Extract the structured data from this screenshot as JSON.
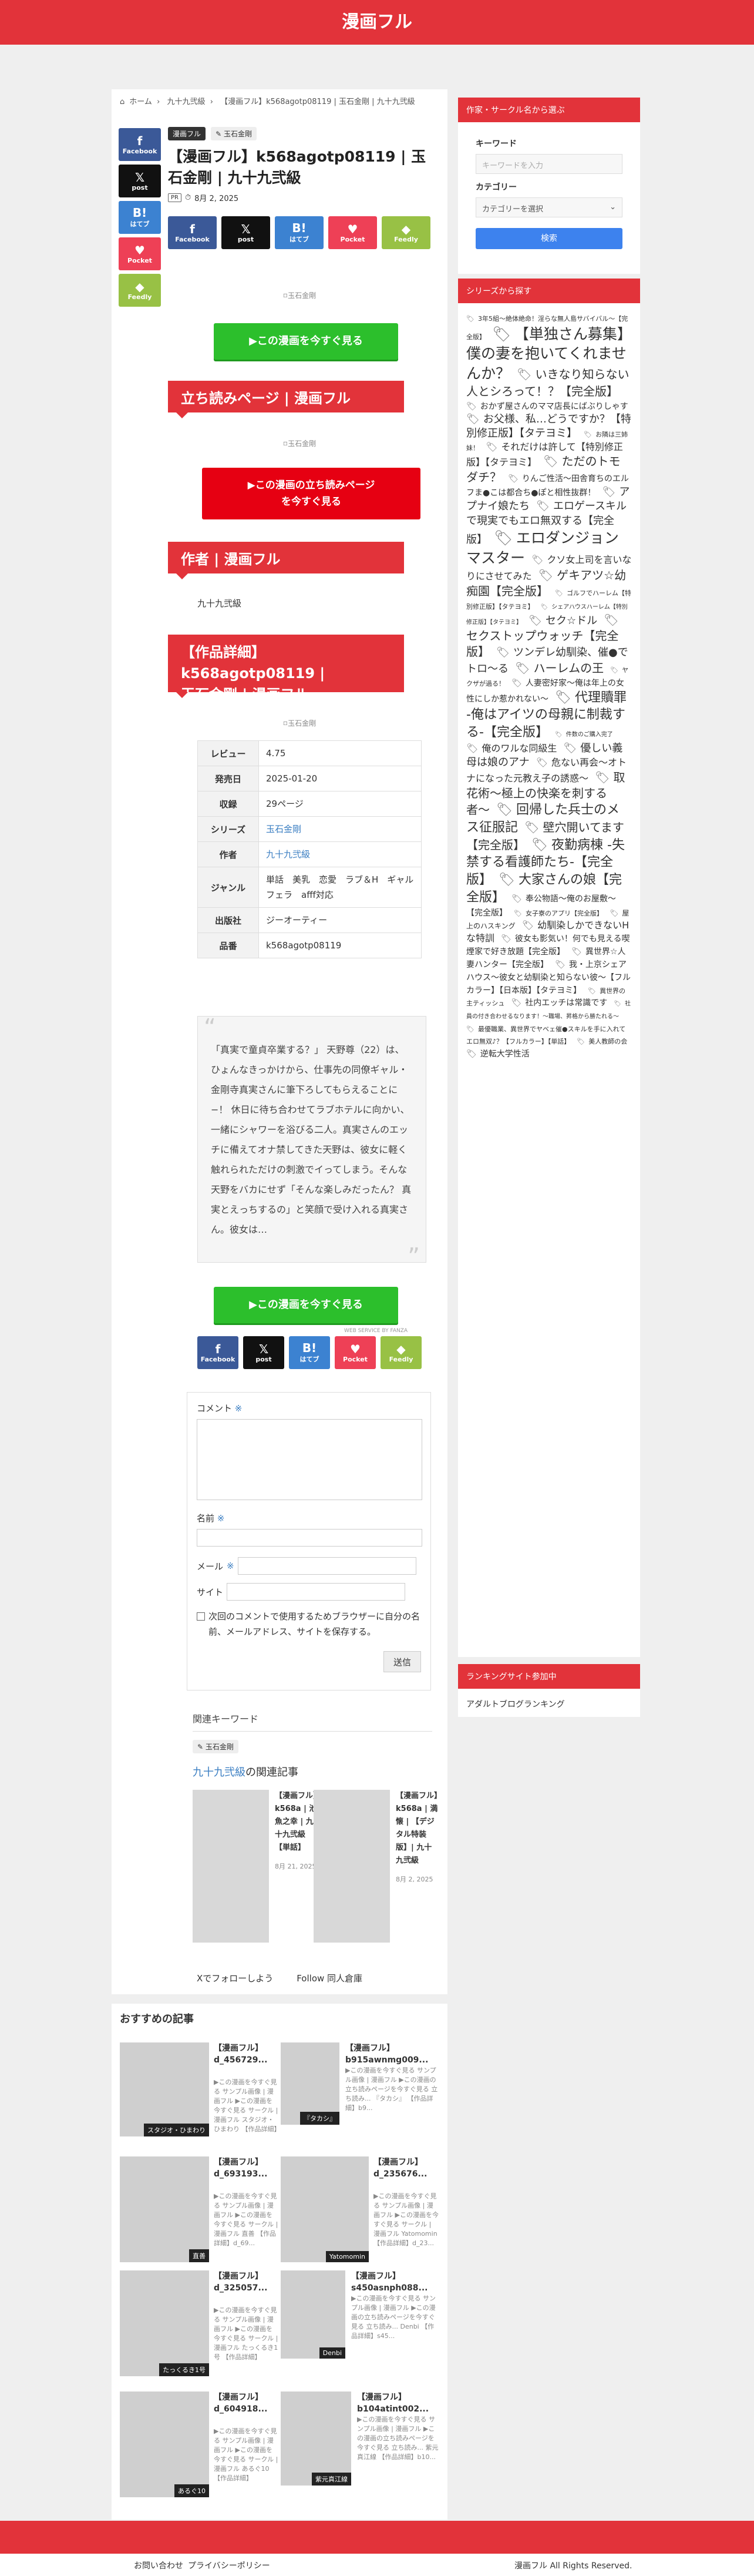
{
  "site": {
    "name": "漫画フル"
  },
  "breadcrumb": [
    "ホーム",
    "九十九弐級",
    "【漫画フル】k568agotp08119 | 玉石金剛 | 九十九弐級"
  ],
  "share": {
    "facebook": "Facebook",
    "x": "post",
    "hatena": "はてブ",
    "pocket": "Pocket",
    "feedly": "Feedly"
  },
  "article": {
    "categories": [
      "漫画フル",
      "玉石金剛"
    ],
    "title": "【漫画フル】k568agotp08119 | 玉石金剛 | 九十九弐級",
    "pr": "PR",
    "date": "8月 2, 2025",
    "image_alt": "玉石金剛",
    "cta_green": "▶この漫画を今すぐ見る",
    "section_read": "立ち読みページ | 漫画フル",
    "cta_read_line1": "▶この漫画の立ち読みページ",
    "cta_read_line2": "を今すぐ見る",
    "section_author": "作者 | 漫画フル",
    "author": "九十九弐級",
    "section_detail_line1": "【作品詳細】k568agotp08119 |",
    "section_detail_line2": "玉石金剛 | 漫画フル",
    "info": [
      {
        "k": "レビュー",
        "v": "4.75"
      },
      {
        "k": "発売日",
        "v": "2025-01-20"
      },
      {
        "k": "収録",
        "v": "29ページ"
      },
      {
        "k": "シリーズ",
        "v": "玉石金剛"
      },
      {
        "k": "作者",
        "v": "九十九弐級"
      },
      {
        "k": "ジャンル",
        "v": "単話　美乳　恋愛　ラブ＆H　ギャル　フェラ　afff対応"
      },
      {
        "k": "出版社",
        "v": "ジーオーティー"
      },
      {
        "k": "品番",
        "v": "k568agotp08119"
      }
    ],
    "description": "「真実で童貞卒業する？」 天野尊（22）は、ひょんなきっかけから、仕事先の同僚ギャル・金剛寺真実さんに筆下ろしてもらえることに−！ 休日に待ち合わせてラブホテルに向かい、一緒にシャワーを浴びる二人。真実さんのエッチに備えてオナ禁してきた天野は、彼女に軽く触れられただけの刺激でイってしまう。そんな天野をバカにせず「そんな楽しみだったん？ 真実とえっちするの」と笑顔で受け入れる真実さん。彼女は…",
    "fanza_credit": "WEB SERVICE BY FANZA"
  },
  "comment_form": {
    "comment_label": "コメント",
    "name_label": "名前",
    "email_label": "メール",
    "site_label": "サイト",
    "save_label": "次回のコメントで使用するためブラウザーに自分の名前、メールアドレス、サイトを保存する。",
    "submit": "送信",
    "required_mark": "※"
  },
  "keywords": {
    "title": "関連キーワード",
    "items": [
      "玉石金剛"
    ]
  },
  "related": {
    "title_link": "九十九弐級",
    "title_rest": "の関連記事",
    "items": [
      {
        "title": "【漫画フル】k568a | 池魚之幸 | 九十九弐級【単話】",
        "date": "8月 21, 2025"
      },
      {
        "title": "【漫画フル】k568a | 満懐 | 【デジタル特装版】| 九十九弐級",
        "date": "8月 2, 2025"
      }
    ]
  },
  "follow": {
    "x": "Xでフォローしよう",
    "site": "Follow 同人倉庫"
  },
  "recommend": {
    "title": "おすすめの記事",
    "items": [
      {
        "title": "【漫画フル】d_456729...",
        "ex": "▶この漫画を今すぐ見る サンプル画像 | 漫画フル ▶この漫画を今すぐ見る サークル | 漫画フル スタジオ・ひまわり 【作品詳細】d_45...",
        "label": "スタジオ・ひまわり"
      },
      {
        "title": "【漫画フル】b915awnmg009...",
        "ex": "▶この漫画を今すぐ見る サンプル画像 | 漫画フル ▶この漫画の立ち読みページを今すぐ見る 立ち読み... 『タカシ』 【作品詳細】b9...",
        "label": "『タカシ』"
      },
      {
        "title": "【漫画フル】d_693193...",
        "ex": "▶この漫画を今すぐ見る サンプル画像 | 漫画フル ▶この漫画を今すぐ見る サークル | 漫画フル 直善 【作品詳細】d_69...",
        "label": "直善"
      },
      {
        "title": "【漫画フル】d_235676...",
        "ex": "▶この漫画を今すぐ見る サンプル画像 | 漫画フル ▶この漫画を今すぐ見る サークル | 漫画フル Yatomomin 【作品詳細】d_23...",
        "label": "Yatomomin"
      },
      {
        "title": "【漫画フル】d_325057...",
        "ex": "▶この漫画を今すぐ見る サンプル画像 | 漫画フル ▶この漫画を今すぐ見る サークル | 漫画フル たっくるき1号 【作品詳細】d_3250...",
        "label": "たっくるき1号"
      },
      {
        "title": "【漫画フル】s450asnph088...",
        "ex": "▶この漫画を今すぐ見る サンプル画像 | 漫画フル ▶この漫画の立ち読みページを今すぐ見る 立ち読み... Denbi 【作品詳細】s45...",
        "label": "Denbi"
      },
      {
        "title": "【漫画フル】d_604918...",
        "ex": "▶この漫画を今すぐ見る サンプル画像 | 漫画フル ▶この漫画を今すぐ見る サークル | 漫画フル あるぐ10 【作品詳細】d_60491...",
        "label": "あるぐ10"
      },
      {
        "title": "【漫画フル】b104atint002...",
        "ex": "▶この漫画を今すぐ見る サンプル画像 | 漫画フル ▶この漫画の立ち読みページを今すぐ見る 立ち読み... 紫元真江線 【作品詳細】b10...",
        "label": "紫元真江線"
      }
    ]
  },
  "sidebar": {
    "search": {
      "header": "作家・サークル名から選ぶ",
      "keyword_label": "キーワード",
      "keyword_placeholder": "キーワードを入力",
      "category_label": "カテゴリー",
      "category_value": "カテゴリーを選択",
      "button": "検索"
    },
    "series": {
      "header": "シリーズから探す",
      "tags": [
        {
          "t": "3年5組〜絶体絶命！淫らな無人島サバイバル〜【完全版】",
          "s": 11
        },
        {
          "t": "【単独さん募集】僕の妻を抱いてくれませんか？",
          "s": 25
        },
        {
          "t": "いきなり知らない人とシろって！？【完全版】",
          "s": 20
        },
        {
          "t": "おかず屋さんのママ店長にばぶりしゃす",
          "s": 14
        },
        {
          "t": "お父様、私…どうですか？【特別修正版】【タテヨミ】",
          "s": 18
        },
        {
          "t": "お隣は三姉妹！",
          "s": 11
        },
        {
          "t": "それだけは許して【特別修正版】【タテヨミ】",
          "s": 16
        },
        {
          "t": "ただのトモダチ？",
          "s": 20
        },
        {
          "t": "りんご性活〜田舎育ちのエルフま●こは都合ち●ぽと相性抜群！",
          "s": 14
        },
        {
          "t": "アプナイ娘たち",
          "s": 18
        },
        {
          "t": "エロゲースキルで現実でもエロ無双する【完全版】",
          "s": 18
        },
        {
          "t": "エロダンジョンマスター",
          "s": 25
        },
        {
          "t": "クソ女上司を言いなりにさせてみた",
          "s": 16
        },
        {
          "t": "ゲキアツ☆幼痴園【完全版】",
          "s": 20
        },
        {
          "t": "ゴルフでハーレム【特別修正版】【タテヨミ】",
          "s": 11
        },
        {
          "t": "シェアハウスハーレム【特別修正版】【タテヨミ】",
          "s": 10
        },
        {
          "t": "セク☆ドル",
          "s": 18
        },
        {
          "t": "セクストップウォッチ【完全版】",
          "s": 20
        },
        {
          "t": "ツンデレ幼馴染、催●でトロ〜る",
          "s": 18
        },
        {
          "t": "ハーレムの王",
          "s": 20
        },
        {
          "t": "ヤクザが過る！",
          "s": 11
        },
        {
          "t": "人妻密好家〜俺は年上の女性にしか惹かれない〜",
          "s": 14
        },
        {
          "t": "代理贖罪 -俺はアイツの母親に制裁する-【完全版】",
          "s": 22
        },
        {
          "t": "件数のご購入完了",
          "s": 10
        },
        {
          "t": "俺のワルな同級生",
          "s": 16
        },
        {
          "t": "優しい義母は娘のアナ",
          "s": 18
        },
        {
          "t": "危ない再会〜オトナになった元教え子の誘惑〜",
          "s": 16
        },
        {
          "t": "取花術〜極上の快楽を刺する者〜",
          "s": 20
        },
        {
          "t": "回帰した兵士のメス征服記",
          "s": 22
        },
        {
          "t": "壁穴開いてます【完全版】",
          "s": 20
        },
        {
          "t": "夜勤病棟 -失禁する看護師たち-【完全版】",
          "s": 22
        },
        {
          "t": "大家さんの娘【完全版】",
          "s": 22
        },
        {
          "t": "奉公物語〜俺のお屋敷〜【完全版】",
          "s": 14
        },
        {
          "t": "女子寮のアプリ【完全版】",
          "s": 11
        },
        {
          "t": "屋上のハスキング",
          "s": 12
        },
        {
          "t": "幼馴染しかできないHな特訓",
          "s": 16
        },
        {
          "t": "彼女も影気い！何でも見える喫煙家で好き放題【完全版】",
          "s": 14
        },
        {
          "t": "異世界☆人妻ハンター【完全版】",
          "s": 14
        },
        {
          "t": "我・上京シェアハウス〜彼女と幼馴染と知らない彼〜【フルカラー】【日本版】【タテヨミ】",
          "s": 14
        },
        {
          "t": "異世界の主ティッシュ",
          "s": 11
        },
        {
          "t": "社内エッチは常識です",
          "s": 14
        },
        {
          "t": "社員の付き合わせるなります！〜職場、昇格から勝たれる〜",
          "s": 10
        },
        {
          "t": "最優職業、異世界でヤベェ催●スキルを手に入れてエロ無双♪？【フルカラー】【単話】",
          "s": 11
        },
        {
          "t": "美人教師の会",
          "s": 11
        },
        {
          "t": "逆転大学性活",
          "s": 14
        }
      ]
    },
    "ranking": {
      "header": "ランキングサイト参加中",
      "link": "アダルトブログランキング"
    }
  },
  "footer": {
    "links": [
      "お問い合わせ",
      "プライバシーポリシー"
    ],
    "copyright": "漫画フル All Rights Reserved."
  }
}
